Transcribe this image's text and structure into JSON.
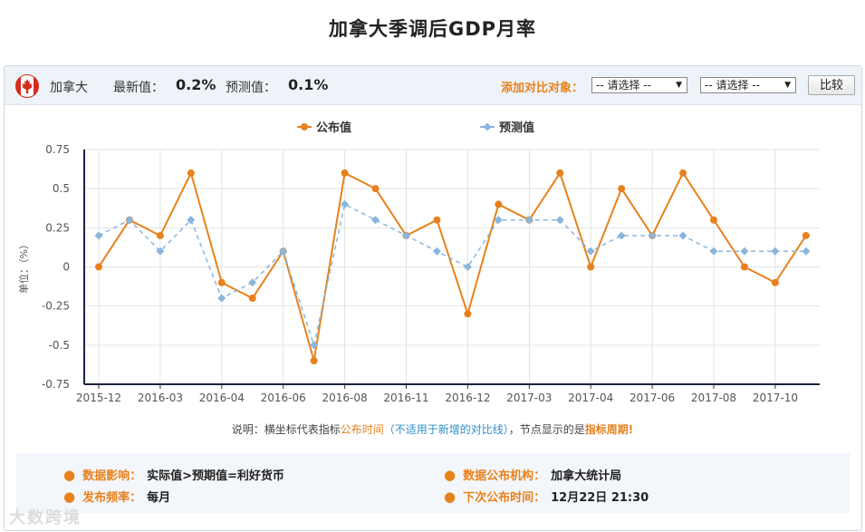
{
  "page": {
    "title": "加拿大季调后GDP月率"
  },
  "header": {
    "country": "加拿大",
    "latest_label": "最新值：",
    "latest_value": "0.2%",
    "forecast_label": "预测值：",
    "forecast_value": "0.1%",
    "compare_label": "添加对比对象：",
    "select1": "-- 请选择 --",
    "select2": "-- 请选择 --",
    "compare_button": "比较",
    "flag_colors": {
      "red": "#d52b1e",
      "white": "#ffffff"
    }
  },
  "chart_data": {
    "type": "line",
    "title": "",
    "ylabel": "单位：（%）",
    "xlabel": "",
    "ylim": [
      -0.75,
      0.75
    ],
    "yticks": [
      0.75,
      0.5,
      0.25,
      0,
      -0.25,
      -0.5,
      -0.75
    ],
    "ytick_labels": [
      "0.75",
      "0.5",
      "0.25",
      "0",
      "-0.25",
      "-0.5",
      "-0.75"
    ],
    "x_tick_labels": [
      {
        "index": 0,
        "label": "2015-12"
      },
      {
        "index": 2,
        "label": "2016-03"
      },
      {
        "index": 4,
        "label": "2016-04"
      },
      {
        "index": 6,
        "label": "2016-06"
      },
      {
        "index": 8,
        "label": "2016-08"
      },
      {
        "index": 10,
        "label": "2016-11"
      },
      {
        "index": 12,
        "label": "2016-12"
      },
      {
        "index": 14,
        "label": "2017-03"
      },
      {
        "index": 16,
        "label": "2017-04"
      },
      {
        "index": 18,
        "label": "2017-06"
      },
      {
        "index": 20,
        "label": "2017-08"
      },
      {
        "index": 22,
        "label": "2017-10"
      }
    ],
    "point_count": 24,
    "grid": true,
    "legend_position": "top-center",
    "series": [
      {
        "name": "公布值",
        "color": "#e8811c",
        "style": "solid",
        "values": [
          0,
          0.3,
          0.2,
          0.6,
          -0.1,
          -0.2,
          0.1,
          -0.6,
          0.6,
          0.5,
          0.2,
          0.3,
          -0.3,
          0.4,
          0.3,
          0.6,
          0,
          0.5,
          0.2,
          0.6,
          0.3,
          0,
          -0.1,
          0.2
        ]
      },
      {
        "name": "预测值",
        "color": "#8ab6dc",
        "style": "dashed",
        "values": [
          0.2,
          0.3,
          0.1,
          0.3,
          -0.2,
          -0.1,
          0.1,
          -0.5,
          0.4,
          0.3,
          0.2,
          0.1,
          0,
          0.3,
          0.3,
          0.3,
          0.1,
          0.2,
          0.2,
          0.2,
          0.1,
          0.1,
          0.1,
          0.1
        ]
      }
    ]
  },
  "note": {
    "prefix": "说明：横坐标代表指标",
    "publish_time": "公布时间",
    "paren": "（不适用于新增的对比线）",
    "mid": "，节点显示的是",
    "period": "指标周期!"
  },
  "info": {
    "impact_label": "数据影响：",
    "impact_value": "实际值>预期值=利好货币",
    "agency_label": "数据公布机构：",
    "agency_value": "加拿大统计局",
    "freq_label": "发布频率：",
    "freq_value": "每月",
    "next_label": "下次公布时间：",
    "next_value": "12月22日 21:30"
  },
  "watermark": "大数跨境"
}
